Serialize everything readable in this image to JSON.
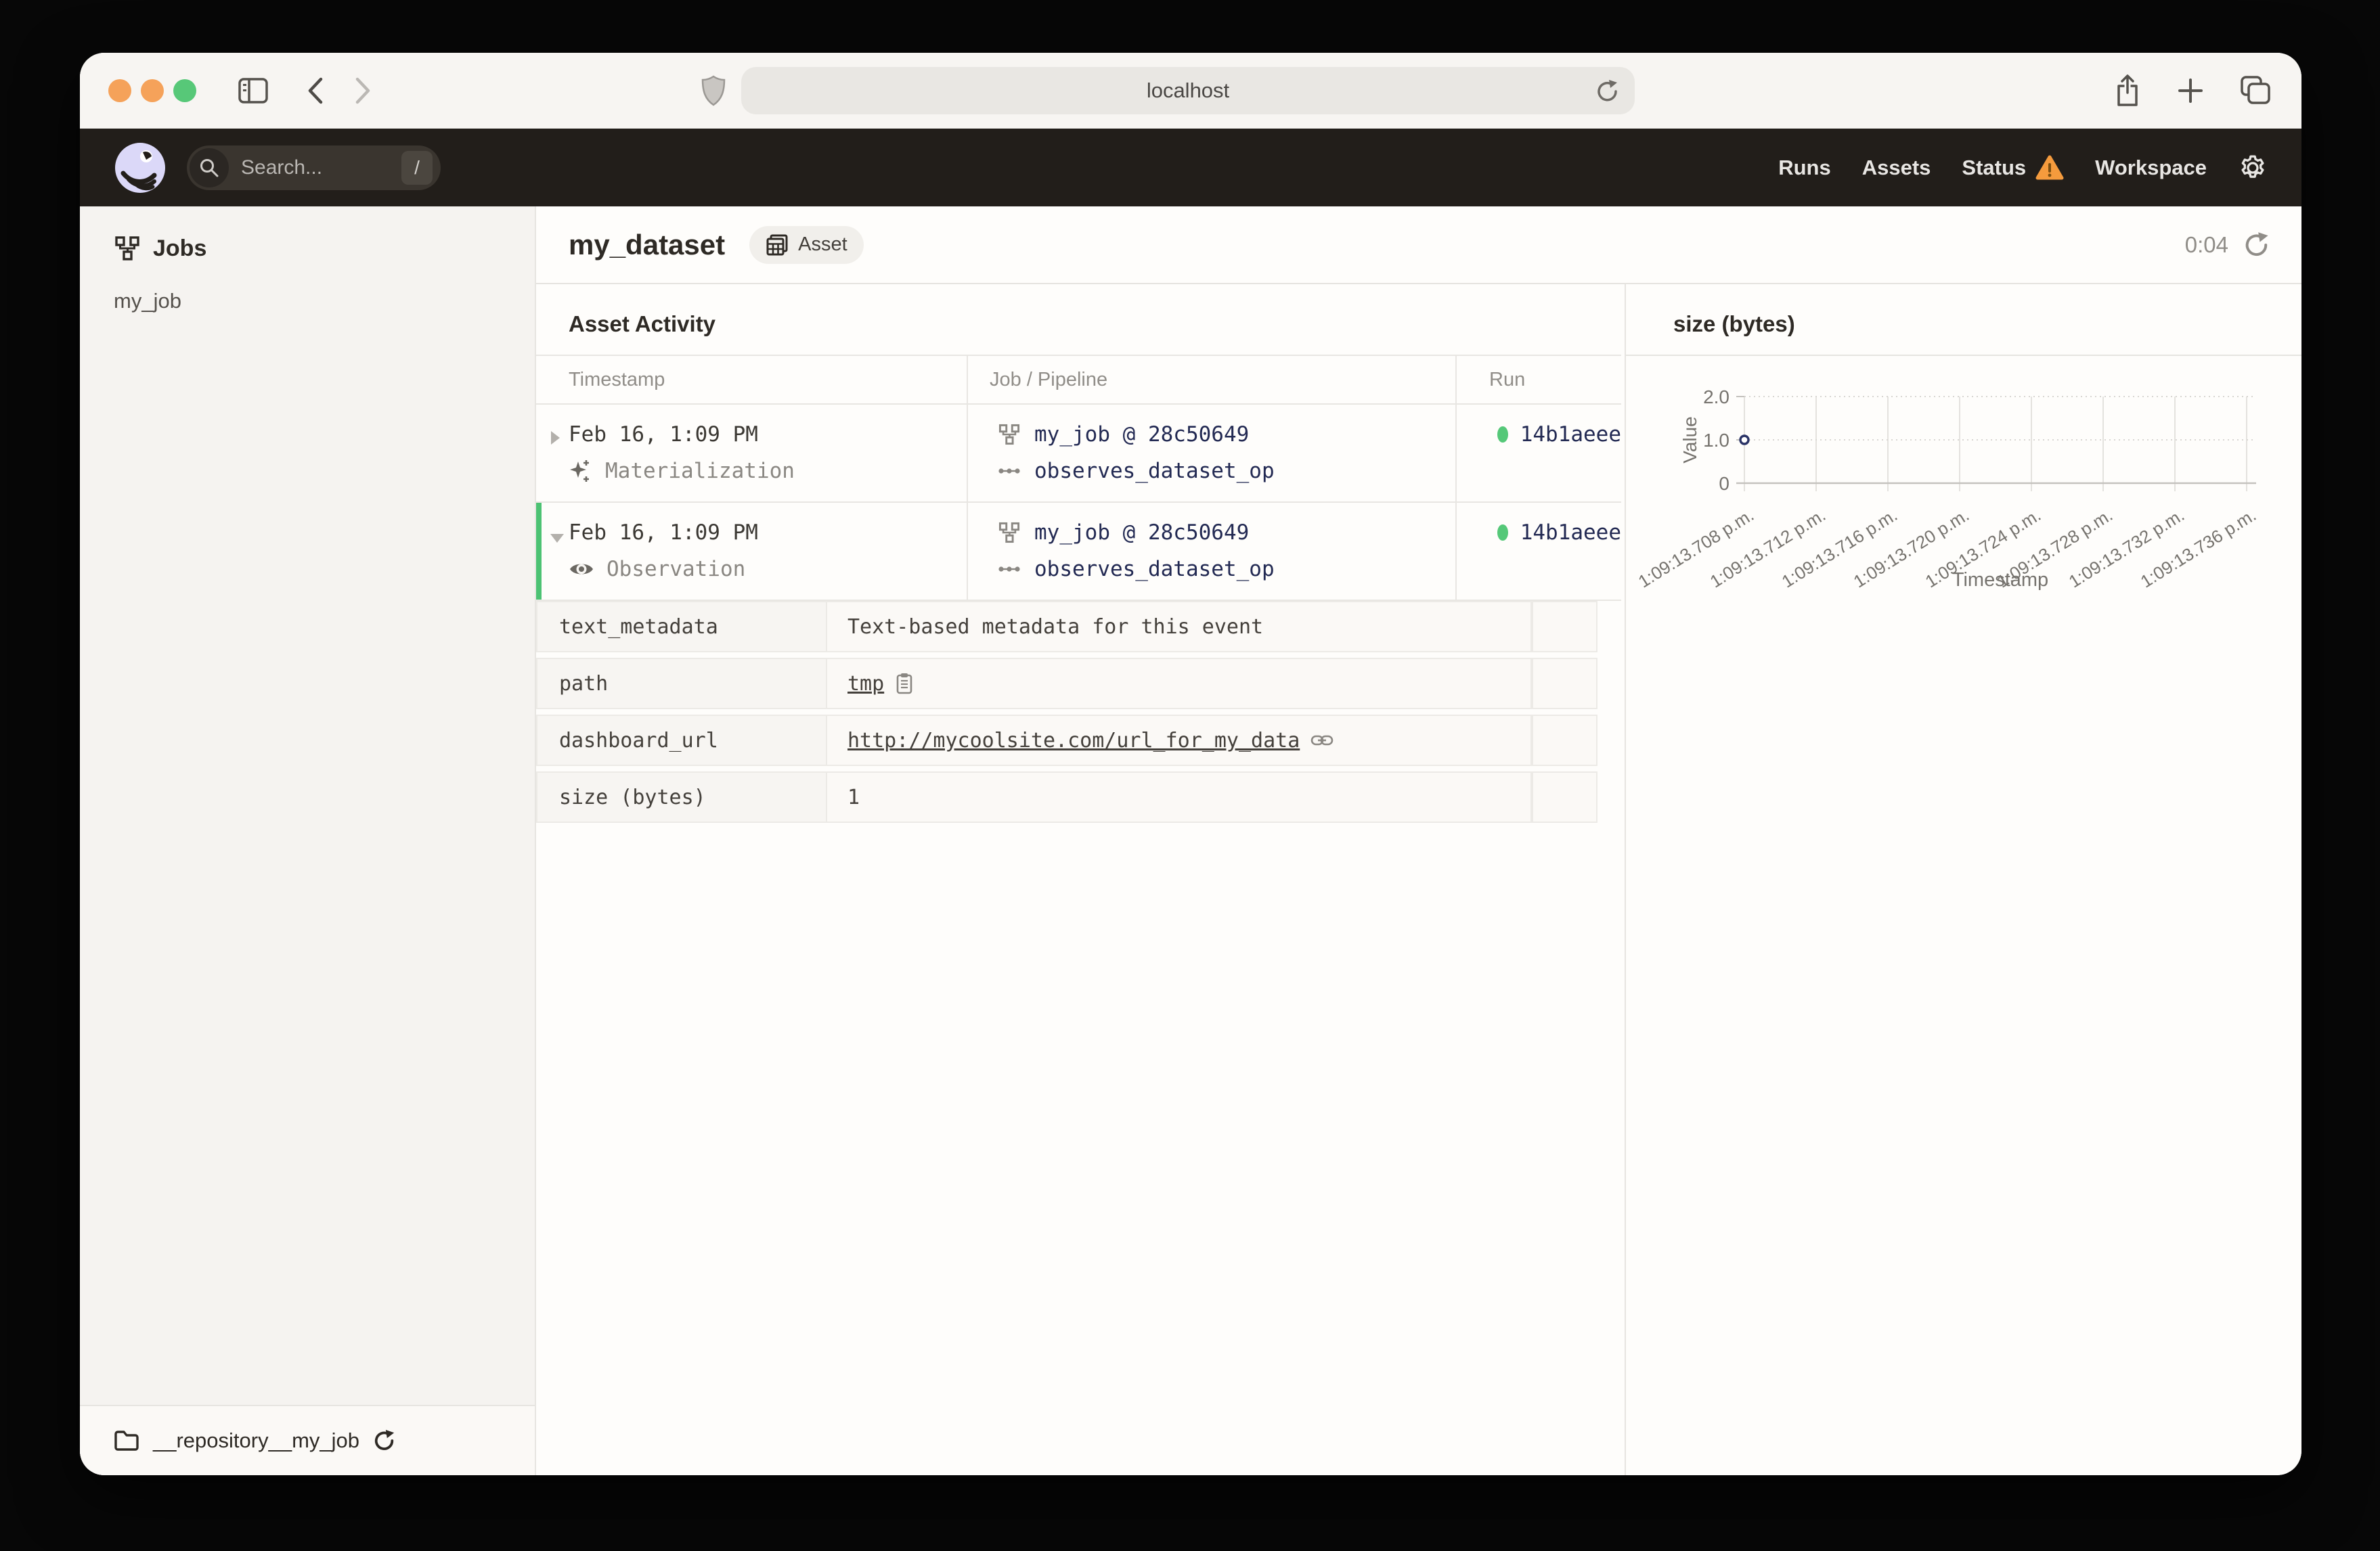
{
  "browser": {
    "url": "localhost"
  },
  "app_header": {
    "search_placeholder": "Search...",
    "search_shortcut": "/",
    "nav": [
      {
        "label": "Runs"
      },
      {
        "label": "Assets"
      },
      {
        "label": "Status"
      },
      {
        "label": "Workspace"
      }
    ]
  },
  "sidebar": {
    "section_title": "Jobs",
    "items": [
      {
        "label": "my_job"
      }
    ],
    "footer": {
      "repository": "__repository__my_job"
    }
  },
  "page": {
    "title": "my_dataset",
    "badge": "Asset",
    "timer": "0:04"
  },
  "activity": {
    "title": "Asset Activity",
    "columns": {
      "timestamp": "Timestamp",
      "job": "Job / Pipeline",
      "run": "Run"
    },
    "rows": [
      {
        "timestamp": "Feb 16, 1:09 PM",
        "event_type": "Materialization",
        "job": "my_job @ 28c50649",
        "op": "observes_dataset_op",
        "run_id": "14b1aeee"
      },
      {
        "timestamp": "Feb 16, 1:09 PM",
        "event_type": "Observation",
        "job": "my_job @ 28c50649",
        "op": "observes_dataset_op",
        "run_id": "14b1aeee"
      }
    ],
    "metadata": [
      {
        "key": "text_metadata",
        "value": "Text-based metadata for this event"
      },
      {
        "key": "path",
        "value": "tmp"
      },
      {
        "key": "dashboard_url",
        "value": "http://mycoolsite.com/url_for_my_data"
      },
      {
        "key": "size (bytes)",
        "value": "1"
      }
    ]
  },
  "chart_data": {
    "type": "scatter",
    "title": "size (bytes)",
    "xlabel": "Timestamp",
    "ylabel": "Value",
    "ylim": [
      0,
      2
    ],
    "y_ticks": [
      {
        "label": "0",
        "value": 0
      },
      {
        "label": "1.0",
        "value": 1
      },
      {
        "label": "2.0",
        "value": 2
      }
    ],
    "x_tick_labels": [
      "1:09:13.708 p.m.",
      "1:09:13.712 p.m.",
      "1:09:13.716 p.m.",
      "1:09:13.720 p.m.",
      "1:09:13.724 p.m.",
      "1:09:13.728 p.m.",
      "1:09:13.732 p.m.",
      "1:09:13.736 p.m."
    ],
    "grid": true,
    "points": [
      {
        "x_index": 0,
        "y": 1
      }
    ]
  },
  "colors": {
    "header_bg": "#221E1A",
    "accent_green": "#55C878",
    "link_navy": "#232A53",
    "warning_orange": "#F59B3D",
    "logo_lavender": "#DBD8F8"
  }
}
